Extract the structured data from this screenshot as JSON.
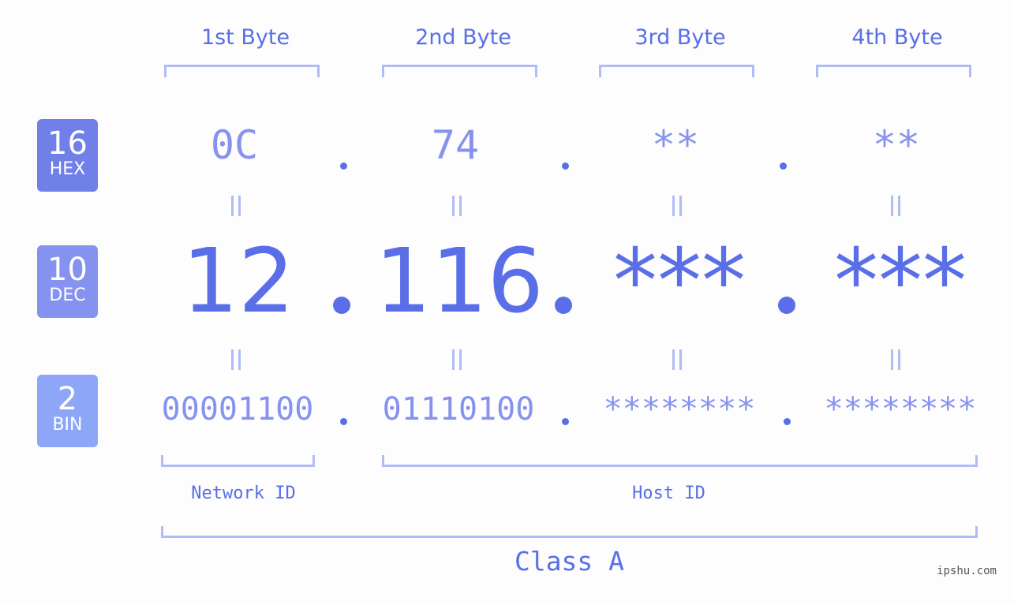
{
  "colors": {
    "accent": "#5a6ee8",
    "light_accent": "#8792ee",
    "bracket": "#b0bcf6",
    "hex_badge": "#717fe9",
    "dec_badge": "#8592f0",
    "bin_badge": "#8ea6f8",
    "background": "#fcfdfc"
  },
  "byte_headers": [
    "1st Byte",
    "2nd Byte",
    "3rd Byte",
    "4th Byte"
  ],
  "badges": {
    "hex": {
      "number": "16",
      "label": "HEX"
    },
    "dec": {
      "number": "10",
      "label": "DEC"
    },
    "bin": {
      "number": "2",
      "label": "BIN"
    }
  },
  "hex": [
    "0C",
    "74",
    "**",
    "**"
  ],
  "dec": [
    "12",
    "116",
    "***",
    "***"
  ],
  "bin": [
    "00001100",
    "01110100",
    "********",
    "********"
  ],
  "groups": {
    "network": "Network ID",
    "host": "Host ID"
  },
  "ip_class": "Class A",
  "watermark": "ipshu.com"
}
